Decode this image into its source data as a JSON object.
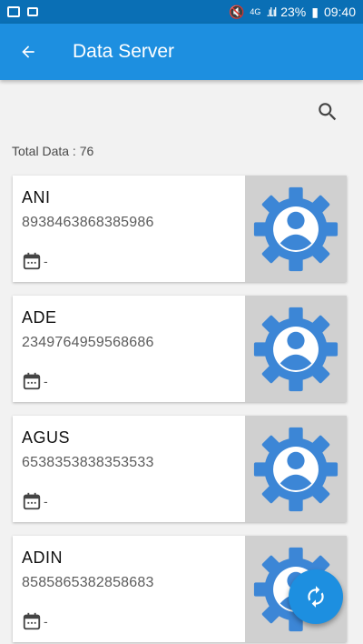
{
  "status_bar": {
    "battery": "23%",
    "time": "09:40",
    "network": "4G"
  },
  "app_bar": {
    "title": "Data Server",
    "back_icon": "arrow-back-icon"
  },
  "toolbar": {
    "search_icon": "search-icon"
  },
  "summary": {
    "total_label": "Total Data : 76"
  },
  "items": [
    {
      "name": "ANI",
      "id": "8938463868385986",
      "date": "-"
    },
    {
      "name": "ADE",
      "id": "2349764959568686",
      "date": "-"
    },
    {
      "name": "AGUS",
      "id": "6538353838353533",
      "date": "-"
    },
    {
      "name": "ADIN",
      "id": "8585865382858683",
      "date": "-"
    }
  ],
  "fab": {
    "icon": "refresh-icon"
  },
  "colors": {
    "status_bar": "#0a6fb5",
    "primary": "#1d8fe0",
    "thumb_bg": "#d0d0d0",
    "gear": "#3c86d6"
  }
}
